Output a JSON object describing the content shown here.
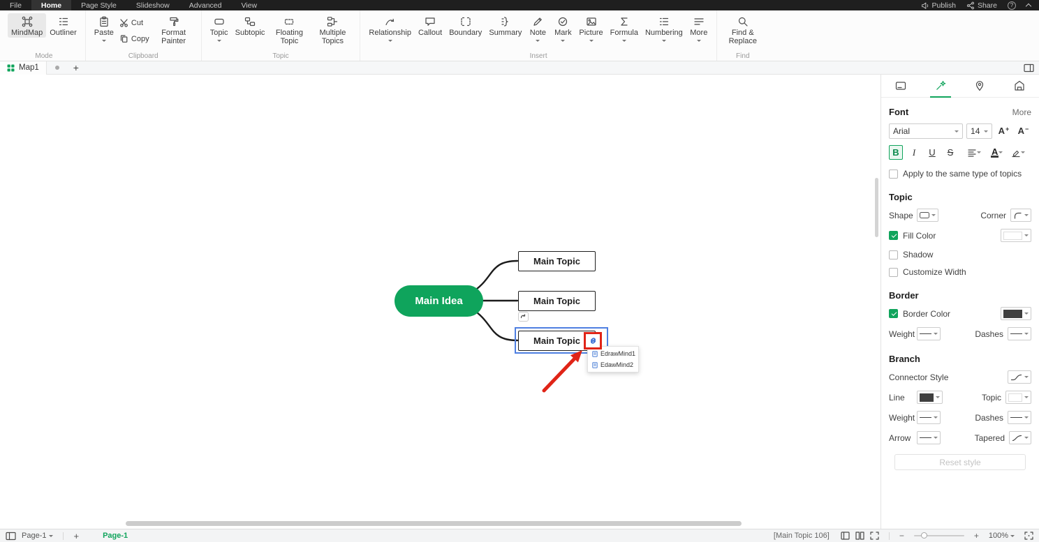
{
  "menubar": {
    "items": [
      "File",
      "Home",
      "Page Style",
      "Slideshow",
      "Advanced",
      "View"
    ],
    "publish_label": "Publish",
    "share_label": "Share"
  },
  "icons": {
    "help_glyph": "?"
  },
  "ribbon": {
    "mode_group": "Mode",
    "mindmap_label": "MindMap",
    "outliner_label": "Outliner",
    "clipboard_group": "Clipboard",
    "paste_label": "Paste",
    "cut_label": "Cut",
    "copy_label": "Copy",
    "format_painter_label": "Format Painter",
    "topic_group": "Topic",
    "topic_label": "Topic",
    "subtopic_label": "Subtopic",
    "floating_topic_label": "Floating Topic",
    "multiple_topics_label": "Multiple Topics",
    "insert_group": "Insert",
    "relationship_label": "Relationship",
    "callout_label": "Callout",
    "boundary_label": "Boundary",
    "summary_label": "Summary",
    "note_label": "Note",
    "mark_label": "Mark",
    "picture_label": "Picture",
    "formula_label": "Formula",
    "numbering_label": "Numbering",
    "more_label": "More",
    "find_group": "Find",
    "find_replace_label": "Find & Replace"
  },
  "tabbar": {
    "map_tab": "Map1",
    "new_tab": "+"
  },
  "canvas": {
    "main_idea": "Main Idea",
    "topics": [
      "Main Topic",
      "Main Topic",
      "Main Topic"
    ],
    "link_menu": [
      "EdrawMind1",
      "EdawMind2"
    ]
  },
  "panel": {
    "font": {
      "title": "Font",
      "more": "More",
      "family": "Arial",
      "size": "14",
      "inc": "A",
      "inc_sign": "+",
      "dec": "A",
      "dec_sign": "−",
      "bold": "B",
      "italic": "I",
      "underline": "U",
      "strike": "S",
      "font_color": "A",
      "apply_label": "Apply to the same type of topics"
    },
    "topic_section": {
      "title": "Topic",
      "shape": "Shape",
      "corner": "Corner",
      "fill_color": "Fill Color",
      "shadow": "Shadow",
      "customize_width": "Customize Width"
    },
    "border_section": {
      "title": "Border",
      "border_color": "Border Color",
      "weight": "Weight",
      "dashes": "Dashes"
    },
    "branch_section": {
      "title": "Branch",
      "connector_style": "Connector Style",
      "line": "Line",
      "topic": "Topic",
      "weight": "Weight",
      "dashes": "Dashes",
      "arrow": "Arrow",
      "tapered": "Tapered",
      "reset": "Reset style"
    }
  },
  "statusbar": {
    "page_select": "Page-1",
    "add_page": "+",
    "page_tab": "Page-1",
    "selection": "[Main Topic 106]",
    "zoom_out": "−",
    "zoom_in": "+",
    "zoom": "100%"
  },
  "colors": {
    "accent_green": "#10A45C",
    "selection_blue": "#4E7FE1",
    "highlight_red": "#E02417"
  }
}
